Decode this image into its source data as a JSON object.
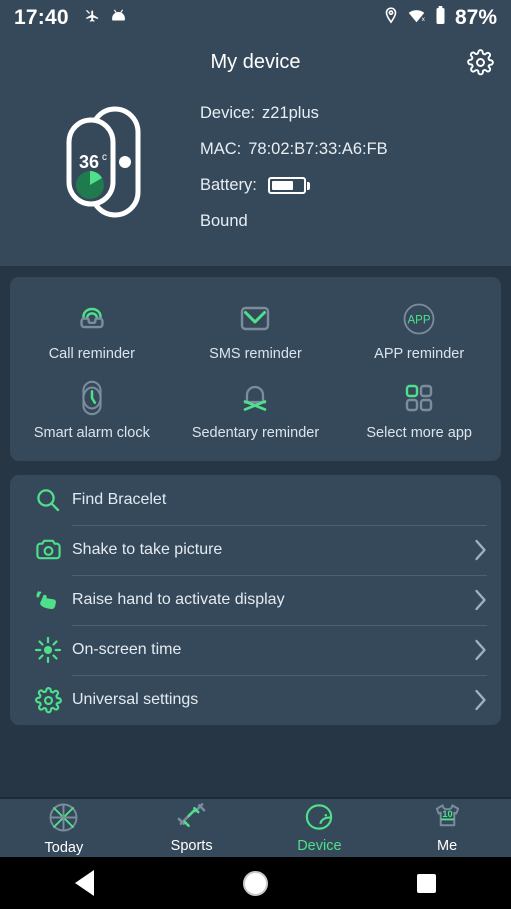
{
  "colors": {
    "accent": "#4ee08a",
    "panel": "#36495a",
    "page_bg": "#263645",
    "text": "#e8eef3",
    "muted_icon": "#7b8c9c"
  },
  "statusbar": {
    "time": "17:40",
    "battery_percent": "87%",
    "left_icons": [
      "airplane-icon",
      "android-head-icon"
    ],
    "right_icons": [
      "location-pin-icon",
      "wifi-off-icon",
      "battery-icon"
    ]
  },
  "header": {
    "title": "My device",
    "settings_icon": "gear-icon"
  },
  "device": {
    "image": "smart-band-icon",
    "band_temperature": "36",
    "band_temperature_unit": "c",
    "name_label": "Device:",
    "name_value": "z21plus",
    "mac_label": "MAC:",
    "mac_value": "78:02:B7:33:A6:FB",
    "battery_label": "Battery:",
    "battery_level_percent": 70,
    "status": "Bound"
  },
  "reminders": [
    {
      "label": "Call reminder",
      "icon": "phone-call-icon"
    },
    {
      "label": "SMS reminder",
      "icon": "envelope-icon"
    },
    {
      "label": "APP reminder",
      "icon": "app-circle-icon",
      "icon_text": "APP"
    },
    {
      "label": "Smart alarm clock",
      "icon": "band-clock-icon"
    },
    {
      "label": "Sedentary reminder",
      "icon": "bell-cross-icon"
    },
    {
      "label": "Select more app",
      "icon": "grid-squares-icon"
    }
  ],
  "settings_list": [
    {
      "label": "Find Bracelet",
      "icon": "search-icon",
      "chevron": false
    },
    {
      "label": "Shake to take picture",
      "icon": "camera-icon",
      "chevron": true
    },
    {
      "label": "Raise hand to activate display",
      "icon": "raise-hand-icon",
      "chevron": true
    },
    {
      "label": "On-screen time",
      "icon": "brightness-sun-icon",
      "chevron": true
    },
    {
      "label": "Universal settings",
      "icon": "gear-icon",
      "chevron": true
    }
  ],
  "bottom_nav": [
    {
      "label": "Today",
      "icon": "basketball-icon",
      "active": false
    },
    {
      "label": "Sports",
      "icon": "dumbbell-icon",
      "active": false
    },
    {
      "label": "Device",
      "icon": "helmet-icon",
      "active": true
    },
    {
      "label": "Me",
      "icon": "jersey-icon",
      "icon_text": "10",
      "active": false
    }
  ],
  "android_nav": {
    "back": "back-triangle-icon",
    "home": "home-circle-icon",
    "recents": "recents-square-icon"
  }
}
